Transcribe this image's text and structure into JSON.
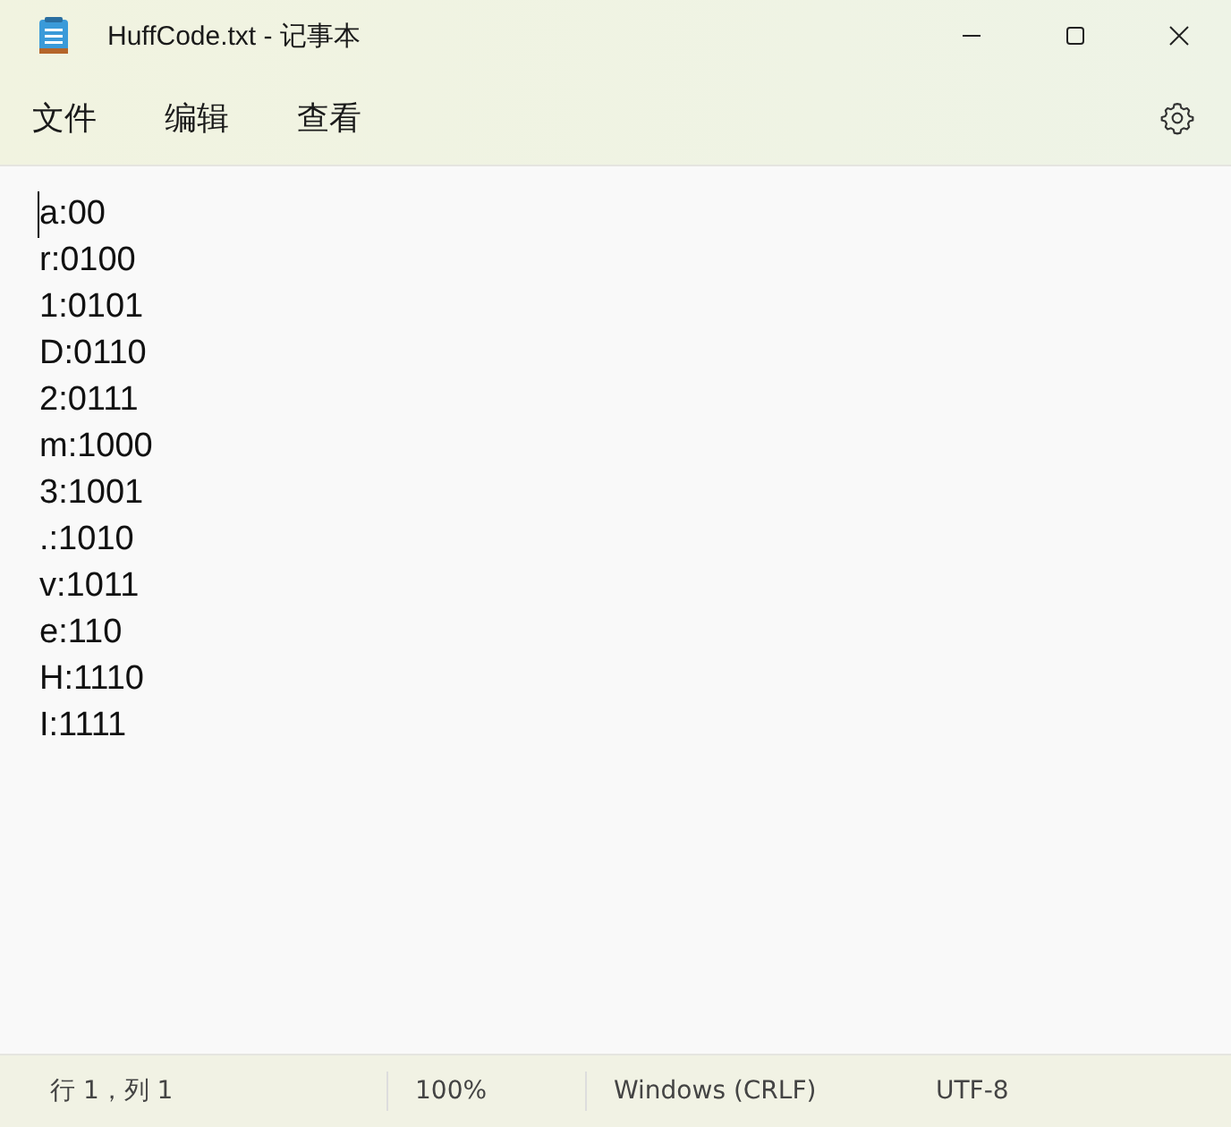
{
  "window": {
    "title": "HuffCode.txt - 记事本"
  },
  "menu": [
    "文件",
    "编辑",
    "查看"
  ],
  "editor": {
    "lines": [
      "a:00",
      "r:0100",
      "1:0101",
      "D:0110",
      "2:0111",
      "m:1000",
      "3:1001",
      ".:1010",
      "v:1011",
      "e:110",
      "H:1110",
      "I:1111"
    ]
  },
  "status_bar": [
    "行 1，列 1",
    "100%",
    "Windows (CRLF)",
    "UTF-8"
  ]
}
